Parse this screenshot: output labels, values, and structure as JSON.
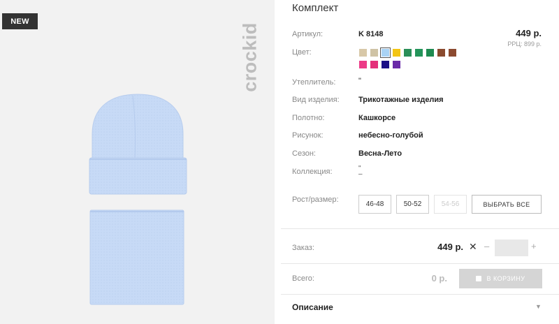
{
  "badge": {
    "new_label": "NEW"
  },
  "brand": {
    "logo_text": "crockid"
  },
  "product": {
    "title": "Комплект",
    "article_label": "Артикул:",
    "article_value": "K 8148",
    "price": "449 р.",
    "rrp": "РРЦ: 899 р.",
    "color_label": "Цвет:",
    "colors": [
      {
        "hex": "#d8c8a8",
        "selected": false
      },
      {
        "hex": "#cfc3a5",
        "selected": false
      },
      {
        "hex": "#a9d3f5",
        "selected": true
      },
      {
        "hex": "#f3c514",
        "selected": false
      },
      {
        "hex": "#2a8f58",
        "selected": false
      },
      {
        "hex": "#24945a",
        "selected": false
      },
      {
        "hex": "#1e8a50",
        "selected": false
      },
      {
        "hex": "#8a4a2e",
        "selected": false
      },
      {
        "hex": "#8c4a30",
        "selected": false
      },
      {
        "hex": "#ec3b87",
        "selected": false
      },
      {
        "hex": "#e4307a",
        "selected": false
      },
      {
        "hex": "#1b0f86",
        "selected": false
      },
      {
        "hex": "#6a2aa8",
        "selected": false
      }
    ],
    "insulation_label": "Утеплитель:",
    "insulation_value": "\"",
    "type_label": "Вид изделия:",
    "type_value": "Трикотажные изделия",
    "fabric_label": "Полотно:",
    "fabric_value": "Кашкорсе",
    "pattern_label": "Рисунок:",
    "pattern_value": "небесно-голубой",
    "season_label": "Сезон:",
    "season_value": "Весна-Лето",
    "collection_label": "Коллекция:",
    "collection_value": "\"\n–",
    "size_label": "Рост/размер:",
    "sizes": [
      {
        "label": "46-48",
        "available": true
      },
      {
        "label": "50-52",
        "available": true
      },
      {
        "label": "54-56",
        "available": false
      }
    ],
    "select_all_label": "ВЫБРАТЬ ВСЕ"
  },
  "order": {
    "label": "Заказ:",
    "price": "449 р.",
    "quantity_value": "",
    "minus_label": "–",
    "plus_label": "+"
  },
  "total": {
    "label": "Всего:",
    "value": "0 р.",
    "cart_button_label": "В КОРЗИНУ"
  },
  "description": {
    "title": "Описание"
  },
  "theme": {
    "accent": "#333333",
    "image_bg": "#f2f2f2",
    "product_blue": "#c9dcf7"
  }
}
